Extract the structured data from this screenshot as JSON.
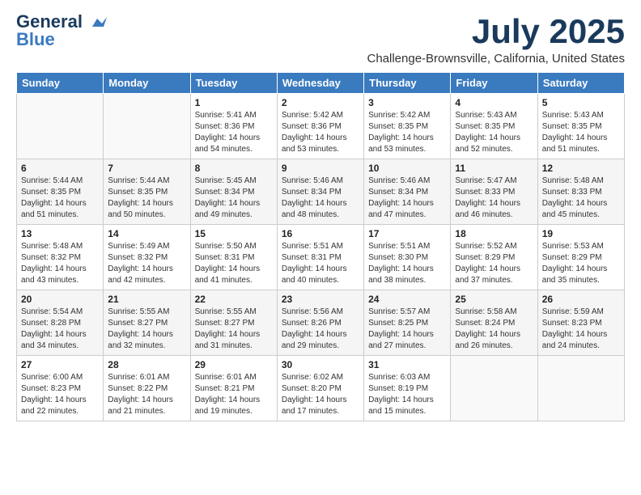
{
  "logo": {
    "line1": "General",
    "line2": "Blue"
  },
  "title": "July 2025",
  "location": "Challenge-Brownsville, California, United States",
  "days_of_week": [
    "Sunday",
    "Monday",
    "Tuesday",
    "Wednesday",
    "Thursday",
    "Friday",
    "Saturday"
  ],
  "weeks": [
    [
      {
        "day": "",
        "info": ""
      },
      {
        "day": "",
        "info": ""
      },
      {
        "day": "1",
        "info": "Sunrise: 5:41 AM\nSunset: 8:36 PM\nDaylight: 14 hours and 54 minutes."
      },
      {
        "day": "2",
        "info": "Sunrise: 5:42 AM\nSunset: 8:36 PM\nDaylight: 14 hours and 53 minutes."
      },
      {
        "day": "3",
        "info": "Sunrise: 5:42 AM\nSunset: 8:35 PM\nDaylight: 14 hours and 53 minutes."
      },
      {
        "day": "4",
        "info": "Sunrise: 5:43 AM\nSunset: 8:35 PM\nDaylight: 14 hours and 52 minutes."
      },
      {
        "day": "5",
        "info": "Sunrise: 5:43 AM\nSunset: 8:35 PM\nDaylight: 14 hours and 51 minutes."
      }
    ],
    [
      {
        "day": "6",
        "info": "Sunrise: 5:44 AM\nSunset: 8:35 PM\nDaylight: 14 hours and 51 minutes."
      },
      {
        "day": "7",
        "info": "Sunrise: 5:44 AM\nSunset: 8:35 PM\nDaylight: 14 hours and 50 minutes."
      },
      {
        "day": "8",
        "info": "Sunrise: 5:45 AM\nSunset: 8:34 PM\nDaylight: 14 hours and 49 minutes."
      },
      {
        "day": "9",
        "info": "Sunrise: 5:46 AM\nSunset: 8:34 PM\nDaylight: 14 hours and 48 minutes."
      },
      {
        "day": "10",
        "info": "Sunrise: 5:46 AM\nSunset: 8:34 PM\nDaylight: 14 hours and 47 minutes."
      },
      {
        "day": "11",
        "info": "Sunrise: 5:47 AM\nSunset: 8:33 PM\nDaylight: 14 hours and 46 minutes."
      },
      {
        "day": "12",
        "info": "Sunrise: 5:48 AM\nSunset: 8:33 PM\nDaylight: 14 hours and 45 minutes."
      }
    ],
    [
      {
        "day": "13",
        "info": "Sunrise: 5:48 AM\nSunset: 8:32 PM\nDaylight: 14 hours and 43 minutes."
      },
      {
        "day": "14",
        "info": "Sunrise: 5:49 AM\nSunset: 8:32 PM\nDaylight: 14 hours and 42 minutes."
      },
      {
        "day": "15",
        "info": "Sunrise: 5:50 AM\nSunset: 8:31 PM\nDaylight: 14 hours and 41 minutes."
      },
      {
        "day": "16",
        "info": "Sunrise: 5:51 AM\nSunset: 8:31 PM\nDaylight: 14 hours and 40 minutes."
      },
      {
        "day": "17",
        "info": "Sunrise: 5:51 AM\nSunset: 8:30 PM\nDaylight: 14 hours and 38 minutes."
      },
      {
        "day": "18",
        "info": "Sunrise: 5:52 AM\nSunset: 8:29 PM\nDaylight: 14 hours and 37 minutes."
      },
      {
        "day": "19",
        "info": "Sunrise: 5:53 AM\nSunset: 8:29 PM\nDaylight: 14 hours and 35 minutes."
      }
    ],
    [
      {
        "day": "20",
        "info": "Sunrise: 5:54 AM\nSunset: 8:28 PM\nDaylight: 14 hours and 34 minutes."
      },
      {
        "day": "21",
        "info": "Sunrise: 5:55 AM\nSunset: 8:27 PM\nDaylight: 14 hours and 32 minutes."
      },
      {
        "day": "22",
        "info": "Sunrise: 5:55 AM\nSunset: 8:27 PM\nDaylight: 14 hours and 31 minutes."
      },
      {
        "day": "23",
        "info": "Sunrise: 5:56 AM\nSunset: 8:26 PM\nDaylight: 14 hours and 29 minutes."
      },
      {
        "day": "24",
        "info": "Sunrise: 5:57 AM\nSunset: 8:25 PM\nDaylight: 14 hours and 27 minutes."
      },
      {
        "day": "25",
        "info": "Sunrise: 5:58 AM\nSunset: 8:24 PM\nDaylight: 14 hours and 26 minutes."
      },
      {
        "day": "26",
        "info": "Sunrise: 5:59 AM\nSunset: 8:23 PM\nDaylight: 14 hours and 24 minutes."
      }
    ],
    [
      {
        "day": "27",
        "info": "Sunrise: 6:00 AM\nSunset: 8:23 PM\nDaylight: 14 hours and 22 minutes."
      },
      {
        "day": "28",
        "info": "Sunrise: 6:01 AM\nSunset: 8:22 PM\nDaylight: 14 hours and 21 minutes."
      },
      {
        "day": "29",
        "info": "Sunrise: 6:01 AM\nSunset: 8:21 PM\nDaylight: 14 hours and 19 minutes."
      },
      {
        "day": "30",
        "info": "Sunrise: 6:02 AM\nSunset: 8:20 PM\nDaylight: 14 hours and 17 minutes."
      },
      {
        "day": "31",
        "info": "Sunrise: 6:03 AM\nSunset: 8:19 PM\nDaylight: 14 hours and 15 minutes."
      },
      {
        "day": "",
        "info": ""
      },
      {
        "day": "",
        "info": ""
      }
    ]
  ]
}
